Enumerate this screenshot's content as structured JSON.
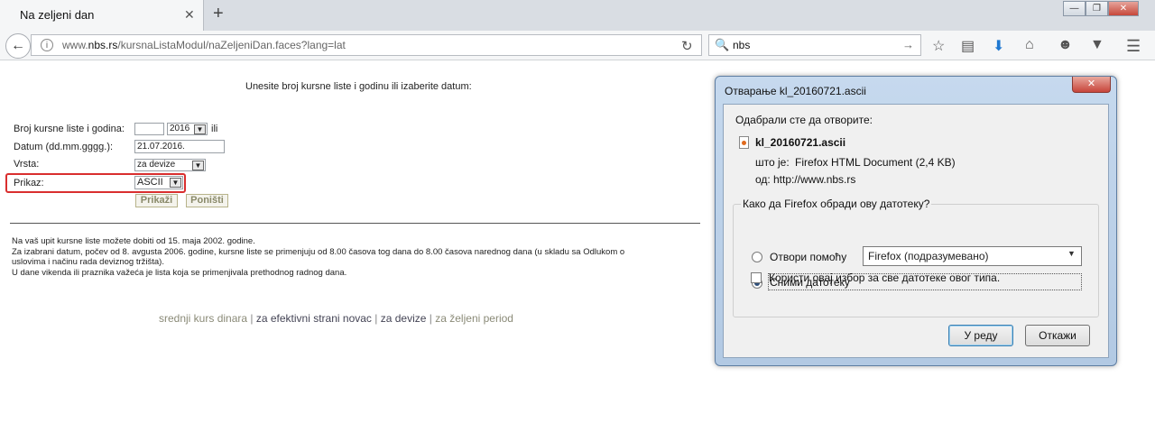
{
  "browser": {
    "tab_title": "Na zeljeni dan",
    "tab_close": "✕",
    "new_tab": "+",
    "url_prefix": "www.",
    "url_domain": "nbs.rs",
    "url_path": "/kursnaListaModul/naZeljeniDan.faces?lang=lat",
    "search_value": "nbs",
    "window_buttons": [
      "—",
      "❐",
      "✕"
    ]
  },
  "page": {
    "intro": "Unesite broj kursne liste i godinu ili izaberite datum:",
    "form": {
      "broj_label": "Broj kursne liste i godina:",
      "broj_value": "",
      "year_value": "2016",
      "ili": "ili",
      "datum_label": "Datum (dd.mm.gggg.):",
      "datum_value": "21.07.2016.",
      "vrsta_label": "Vrsta:",
      "vrsta_value": "za devize",
      "prikaz_label": "Prikaz:",
      "prikaz_value": "ASCII",
      "prikazi_button": "Prikaži",
      "ponisti_button": "Poništi"
    },
    "notes": [
      "Na vaš upit kursne liste možete dobiti od 15. maja 2002. godine.",
      "Za izabrani datum, počev od 8. avgusta 2006. godine, kursne liste se primenjuju od 8.00 časova tog dana do 8.00 časova narednog dana (u skladu sa Odlukom o",
      "uslovima i načinu rada deviznog tržišta).",
      "U dane vikenda ili praznika važeća je lista koja se primenjivala prethodnog radnog dana."
    ],
    "links": [
      "srednji kurs dinara",
      "za efektivni strani novac",
      "za devize",
      "za željeni period"
    ],
    "link_separator": "|"
  },
  "dialog": {
    "title": "Отварање kl_20160721.ascii",
    "close": "✕",
    "opening_label": "Одабрали сте да отворите:",
    "file_name": "kl_20160721.ascii",
    "type_label": "што је:",
    "type_value": "Firefox HTML Document (2,4 KB)",
    "from_label": "од:",
    "from_value": "http://www.nbs.rs",
    "question": "Како да Firefox обради ову датотеку?",
    "open_with_label": "Отвори помоћу",
    "open_with_value": "Firefox (подразумевано)",
    "save_label": "Сними датотеку",
    "remember_label": "Користи овај избор за све датотеке овог типа.",
    "ok_button": "У реду",
    "cancel_button": "Откажи"
  }
}
